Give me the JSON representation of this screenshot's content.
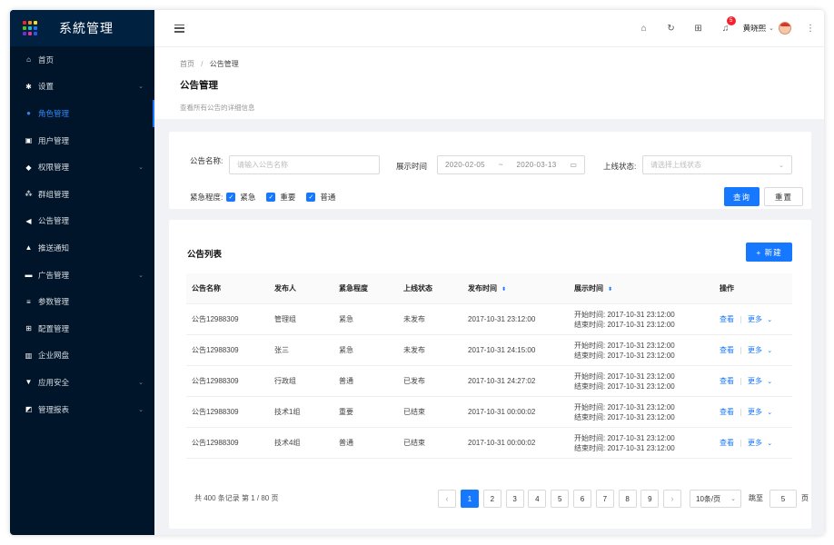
{
  "app": {
    "title": "系統管理",
    "logo_colors": [
      "#f5222d",
      "#fa8c16",
      "#fadb14",
      "#52c41a",
      "#13c2c2",
      "#1677ff",
      "#722ed1",
      "#eb2f96",
      "#2f54eb"
    ]
  },
  "sidebar": {
    "items": [
      {
        "label": "首页",
        "icon": "home-icon",
        "glyph": "⌂",
        "chevron": false,
        "active": false
      },
      {
        "label": "设置",
        "icon": "gear-icon",
        "glyph": "✱",
        "chevron": true,
        "active": false
      },
      {
        "label": "角色管理",
        "icon": "user-circle-icon",
        "glyph": "●",
        "chevron": false,
        "active": true
      },
      {
        "label": "用户管理",
        "icon": "id-card-icon",
        "glyph": "▣",
        "chevron": false,
        "active": false
      },
      {
        "label": "权限管理",
        "icon": "shield-icon",
        "glyph": "◆",
        "chevron": true,
        "active": false
      },
      {
        "label": "群组管理",
        "icon": "team-icon",
        "glyph": "⁂",
        "chevron": false,
        "active": false
      },
      {
        "label": "公告管理",
        "icon": "sound-icon",
        "glyph": "◀",
        "chevron": false,
        "active": false
      },
      {
        "label": "推送通知",
        "icon": "bell-icon",
        "glyph": "▲",
        "chevron": false,
        "active": false
      },
      {
        "label": "广告管理",
        "icon": "ad-icon",
        "glyph": "▬",
        "chevron": true,
        "active": false
      },
      {
        "label": "参数管理",
        "icon": "list-icon",
        "glyph": "≡",
        "chevron": false,
        "active": false
      },
      {
        "label": "配置管理",
        "icon": "config-icon",
        "glyph": "⊞",
        "chevron": false,
        "active": false
      },
      {
        "label": "企业网盘",
        "icon": "disk-icon",
        "glyph": "▥",
        "chevron": false,
        "active": false
      },
      {
        "label": "应用安全",
        "icon": "lock-icon",
        "glyph": "▼",
        "chevron": true,
        "active": false
      },
      {
        "label": "管理报表",
        "icon": "report-icon",
        "glyph": "◩",
        "chevron": true,
        "active": false
      }
    ]
  },
  "header": {
    "notification_count": "5",
    "username": "黄晓熙"
  },
  "page": {
    "breadcrumb_home": "首页",
    "breadcrumb_sep": "/",
    "breadcrumb_current": "公告管理",
    "title": "公告管理",
    "description": "查看所有公告的详细信息"
  },
  "filter": {
    "name_label": "公告名称:",
    "name_placeholder": "请输入公告名称",
    "date_label": "展示时间",
    "date_start": "2020-02-05",
    "date_sep": "~",
    "date_end": "2020-03-13",
    "status_label": "上线状态:",
    "status_placeholder": "请选择上线状态",
    "urgency_label": "紧急程度:",
    "urgency_options": [
      "紧急",
      "重要",
      "普通"
    ],
    "search_button": "查询",
    "reset_button": "重置"
  },
  "list": {
    "title": "公告列表",
    "new_button": "+ 新建",
    "columns": [
      "公告名称",
      "发布人",
      "紧急程度",
      "上线状态",
      "发布时间",
      "展示时间",
      "操作"
    ],
    "start_prefix": "开始时间:",
    "end_prefix": "结束时间:",
    "view_label": "查看",
    "more_label": "更多",
    "rows": [
      {
        "name": "公告12988309",
        "publisher": "管理组",
        "urgency": "紧急",
        "status": "未发布",
        "publish_time": "2017-10-31  23:12:00",
        "start": "2017-10-31  23:12:00",
        "end": "2017-10-31  23:12:00"
      },
      {
        "name": "公告12988309",
        "publisher": "张三",
        "urgency": "紧急",
        "status": "未发布",
        "publish_time": "2017-10-31  24:15:00",
        "start": "2017-10-31  23:12:00",
        "end": "2017-10-31  23:12:00"
      },
      {
        "name": "公告12988309",
        "publisher": "行政组",
        "urgency": "普通",
        "status": "已发布",
        "publish_time": "2017-10-31  24:27:02",
        "start": "2017-10-31  23:12:00",
        "end": "2017-10-31  23:12:00"
      },
      {
        "name": "公告12988309",
        "publisher": "技术1组",
        "urgency": "重要",
        "status": "已结束",
        "publish_time": "2017-10-31  00:00:02",
        "start": "2017-10-31  23:12:00",
        "end": "2017-10-31  23:12:00"
      },
      {
        "name": "公告12988309",
        "publisher": "技术4组",
        "urgency": "普通",
        "status": "已结束",
        "publish_time": "2017-10-31  00:00:02",
        "start": "2017-10-31  23:12:00",
        "end": "2017-10-31  23:12:00"
      }
    ]
  },
  "pagination": {
    "total_text": "共 400 条记录 第 1 / 80 页",
    "pages": [
      "1",
      "2",
      "3",
      "4",
      "5",
      "6",
      "7",
      "8",
      "9"
    ],
    "current_page": "1",
    "page_size": "10条/页",
    "jump_label": "跳至",
    "jump_value": "5",
    "page_suffix": "页"
  }
}
